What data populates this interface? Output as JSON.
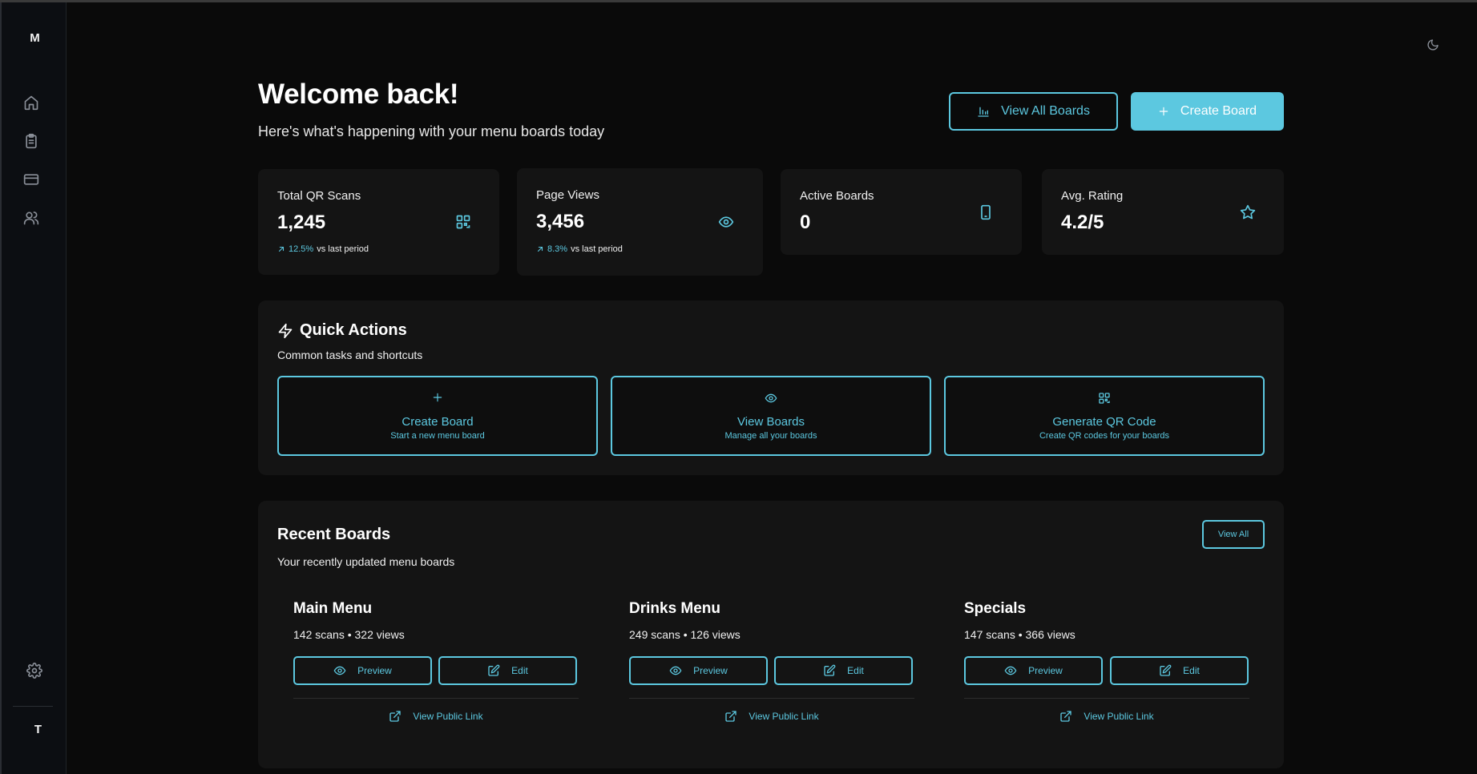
{
  "app": {
    "logo_letter": "M",
    "user_initial": "T"
  },
  "sidebar": {
    "items": [
      {
        "icon": "home-icon"
      },
      {
        "icon": "clipboard-icon"
      },
      {
        "icon": "credit-card-icon"
      },
      {
        "icon": "users-icon"
      }
    ],
    "settings_icon": "gear-icon"
  },
  "header": {
    "title": "Welcome back!",
    "subtitle": "Here's what's happening with your menu boards today",
    "view_all_boards_label": "View All Boards",
    "create_board_label": "Create Board"
  },
  "stats": [
    {
      "label": "Total QR Scans",
      "value": "1,245",
      "trend": "12.5%",
      "trend_suffix": "vs last period",
      "icon": "qr-code-icon"
    },
    {
      "label": "Page Views",
      "value": "3,456",
      "trend": "8.3%",
      "trend_suffix": "vs last period",
      "icon": "eye-icon"
    },
    {
      "label": "Active Boards",
      "value": "0",
      "icon": "smartphone-icon"
    },
    {
      "label": "Avg. Rating",
      "value": "4.2/5",
      "icon": "star-icon"
    }
  ],
  "quick_actions": {
    "title": "Quick Actions",
    "description": "Common tasks and shortcuts",
    "items": [
      {
        "title": "Create Board",
        "subtitle": "Start a new menu board",
        "icon": "plus-icon"
      },
      {
        "title": "View Boards",
        "subtitle": "Manage all your boards",
        "icon": "eye-icon"
      },
      {
        "title": "Generate QR Code",
        "subtitle": "Create QR codes for your boards",
        "icon": "qr-code-icon"
      }
    ]
  },
  "recent_boards": {
    "title": "Recent Boards",
    "description": "Your recently updated menu boards",
    "view_all_label": "View All",
    "preview_label": "Preview",
    "edit_label": "Edit",
    "public_link_label": "View Public Link",
    "boards": [
      {
        "name": "Main Menu",
        "stats": "142 scans • 322 views"
      },
      {
        "name": "Drinks Menu",
        "stats": "249 scans • 126 views"
      },
      {
        "name": "Specials",
        "stats": "147 scans • 366 views"
      }
    ]
  },
  "colors": {
    "accent": "#5cc8e0",
    "background": "#0a0a0a",
    "card": "#141414"
  }
}
